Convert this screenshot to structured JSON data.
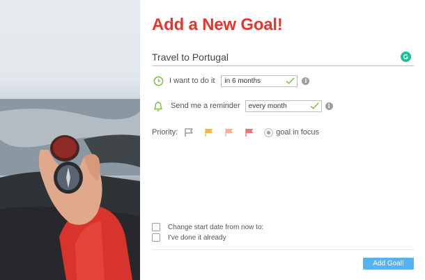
{
  "form": {
    "title": "Add a New Goal!",
    "goal_value": "Travel to Portugal",
    "timeframe_label": "I want to do it",
    "timeframe_value": "in 6 months",
    "reminder_label": "Send me a reminder",
    "reminder_value": "every month",
    "priority_label": "Priority:",
    "priority_flags": [
      "flag-outline-icon",
      "flag-yellow-icon",
      "flag-peach-icon",
      "flag-red-icon"
    ],
    "focus_label": "goal in focus",
    "start_date_label": "Change start date from now to:",
    "done_label": "I've done it already",
    "submit_label": "Add Goal!"
  },
  "colors": {
    "title": "#e5352d",
    "accent_green": "#7cbf3e",
    "button": "#55b4f0",
    "grammarly": "#15c39a",
    "flag_yellow": "#f6b73c",
    "flag_peach": "#f7b58d",
    "flag_red": "#e9737a"
  },
  "icons": {
    "clock": "clock-icon",
    "bell": "bell-icon",
    "info": "info-icon",
    "check": "check-icon",
    "grammarly": "grammarly-icon"
  }
}
